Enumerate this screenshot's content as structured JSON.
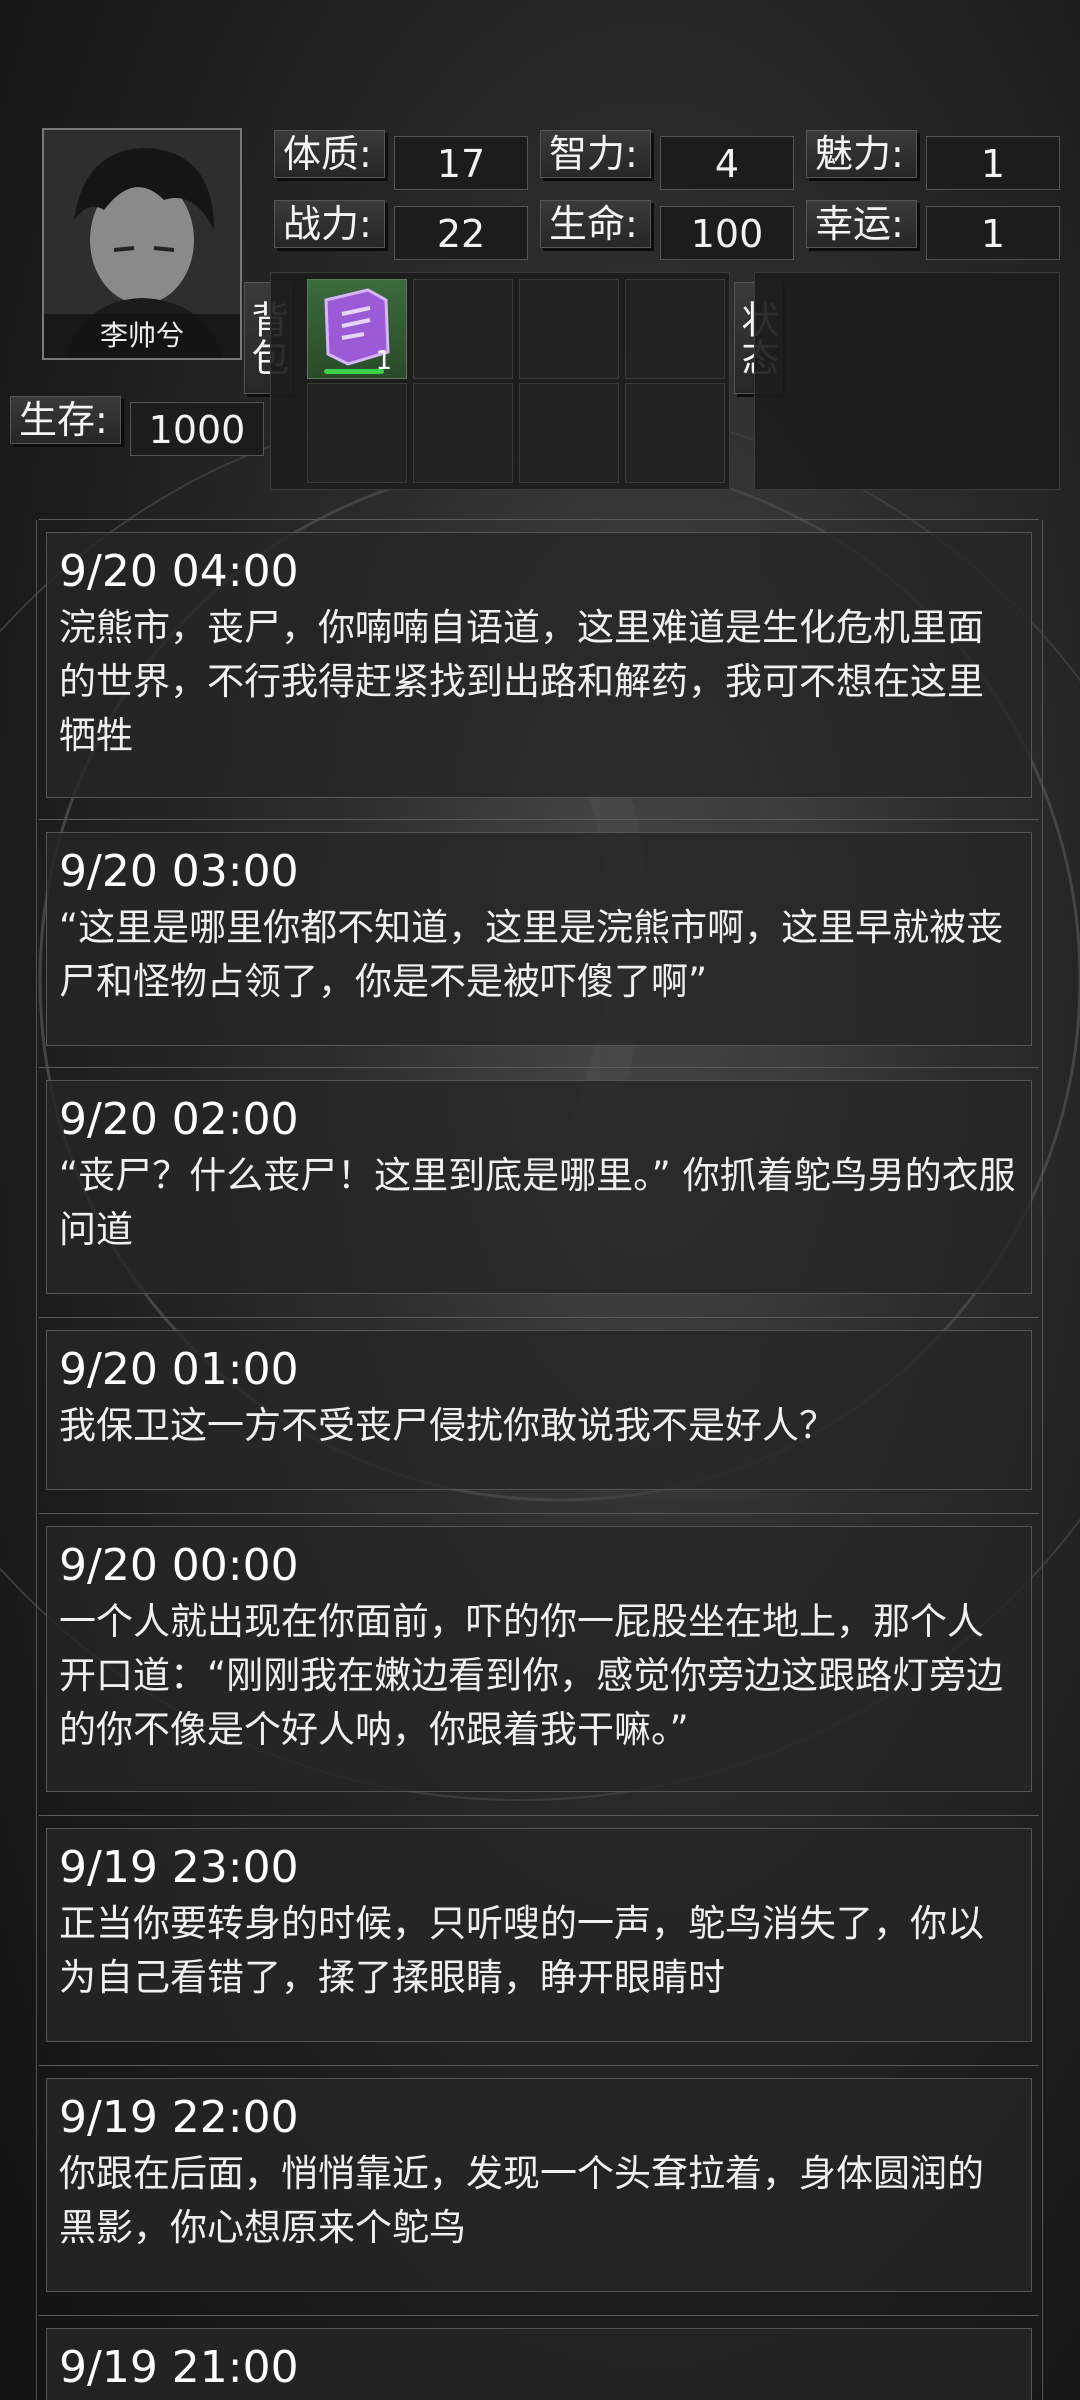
{
  "player": {
    "name": "李帅兮",
    "stats": [
      {
        "label": "体质:",
        "value": "17"
      },
      {
        "label": "智力:",
        "value": "4"
      },
      {
        "label": "魅力:",
        "value": "1"
      },
      {
        "label": "战力:",
        "value": "22"
      },
      {
        "label": "生命:",
        "value": "100"
      },
      {
        "label": "幸运:",
        "value": "1"
      }
    ],
    "survival": {
      "label": "生存:",
      "value": "1000"
    }
  },
  "inventory": {
    "label": "背包",
    "items": [
      {
        "icon": "purple-card-icon",
        "count": "1"
      }
    ]
  },
  "status": {
    "label": "状态"
  },
  "logs": [
    {
      "time": "9/20 04:00",
      "text": "浣熊市，丧尸，你喃喃自语道，这里难道是生化危机里面的世界，不行我得赶紧找到出路和解药，我可不想在这里牺牲"
    },
    {
      "time": "9/20 03:00",
      "text": "“这里是哪里你都不知道，这里是浣熊市啊，这里早就被丧尸和怪物占领了，你是不是被吓傻了啊”"
    },
    {
      "time": "9/20 02:00",
      "text": "“丧尸？什么丧尸！这里到底是哪里。” 你抓着鸵鸟男的衣服问道"
    },
    {
      "time": "9/20 01:00",
      "text": "我保卫这一方不受丧尸侵扰你敢说我不是好人？"
    },
    {
      "time": "9/20 00:00",
      "text": "一个人就出现在你面前，吓的你一屁股坐在地上，那个人开口道：“刚刚我在嫩边看到你，感觉你旁边这跟路灯旁边的你不像是个好人呐，你跟着我干嘛。”"
    },
    {
      "time": "9/19 23:00",
      "text": "正当你要转身的时候，只听嗖的一声，鸵鸟消失了，你以为自己看错了，揉了揉眼睛，睁开眼睛时"
    },
    {
      "time": "9/19 22:00",
      "text": "你跟在后面，悄悄靠近，发现一个头耷拉着，身体圆润的黑影，你心想原来个鸵鸟"
    },
    {
      "time": "9/19 21:00",
      "text": ""
    }
  ]
}
